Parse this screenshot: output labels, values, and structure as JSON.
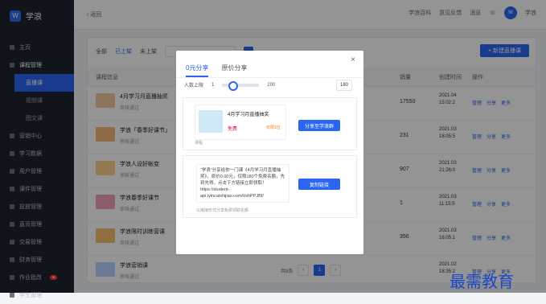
{
  "brand": {
    "logo_text": "学浪",
    "logo_icon": "brand-icon"
  },
  "sidebar": {
    "items": [
      {
        "label": "主页"
      },
      {
        "label": "课程管理",
        "active_parent": true
      },
      {
        "label": "直播课",
        "sub": true,
        "active": true
      },
      {
        "label": "视频课",
        "sub": true
      },
      {
        "label": "图文课",
        "sub": true
      },
      {
        "label": "营销中心"
      },
      {
        "label": "学习数据"
      },
      {
        "label": "用户管理"
      },
      {
        "label": "课件管理"
      },
      {
        "label": "投放管理"
      },
      {
        "label": "直页管理"
      },
      {
        "label": "交易管理"
      },
      {
        "label": "财务管理"
      },
      {
        "label": "作业批改"
      },
      {
        "label": "学生管理"
      }
    ]
  },
  "topbar": {
    "back": "返回",
    "links": [
      "学浪百科",
      "意见反馈",
      "消息"
    ],
    "user": "学浪"
  },
  "list": {
    "filters": [
      "全部",
      "已上架",
      "未上架"
    ],
    "new_button": "+ 新建直播课",
    "headers": [
      "课程信息",
      "销量",
      "创建时间",
      "操作"
    ],
    "rows": [
      {
        "name": "4月学习月直播抽奖",
        "status": "审核通过",
        "sales": "17550",
        "date": "2021.04\n15:02:2"
      },
      {
        "name": "学浪「春季好课节」",
        "status": "审核通过",
        "sales": "231",
        "date": "2021.03\n18:05:5"
      },
      {
        "name": "学浪人设好帐变",
        "status": "审核通过",
        "sales": "907",
        "date": "2021.03\n21:26:0"
      },
      {
        "name": "学浪春季好课节",
        "status": "审核通过",
        "sales": "1",
        "date": "2021.03\n11:15:5"
      },
      {
        "name": "学浪限时训练营课",
        "status": "审核通过",
        "sales": "356",
        "date": "2021.03\n16:05:1"
      },
      {
        "name": "学浪营销课",
        "status": "审核通过",
        "sales": "",
        "date": "2021.02\n18:35:2"
      }
    ],
    "ops": [
      "管理",
      "分享",
      "更多"
    ],
    "pager": {
      "text": "共8条",
      "page": "1"
    }
  },
  "modal": {
    "tabs": [
      "0元分享",
      "原价分享"
    ],
    "quota_label": "人数上限",
    "quota_min": "1",
    "quota_max": "200",
    "quota_value": "180",
    "card1": {
      "title": "4月学习月直播抽奖",
      "price": "免费",
      "tag": "仅限1位",
      "from": "课程",
      "button": "分享至学浪群"
    },
    "card2": {
      "text": "“学浪”分享给你一门课《4月学习月直播抽奖》，原价0.00元，仅限180个免费名额，先到先得，点击下方链接立即领取！https://student-api.iyincaishijiao.com/t/shPPJBf/",
      "button": "复制链接",
      "hint": "以链接形式分享免费领取名额"
    }
  },
  "watermark": "最需教育"
}
